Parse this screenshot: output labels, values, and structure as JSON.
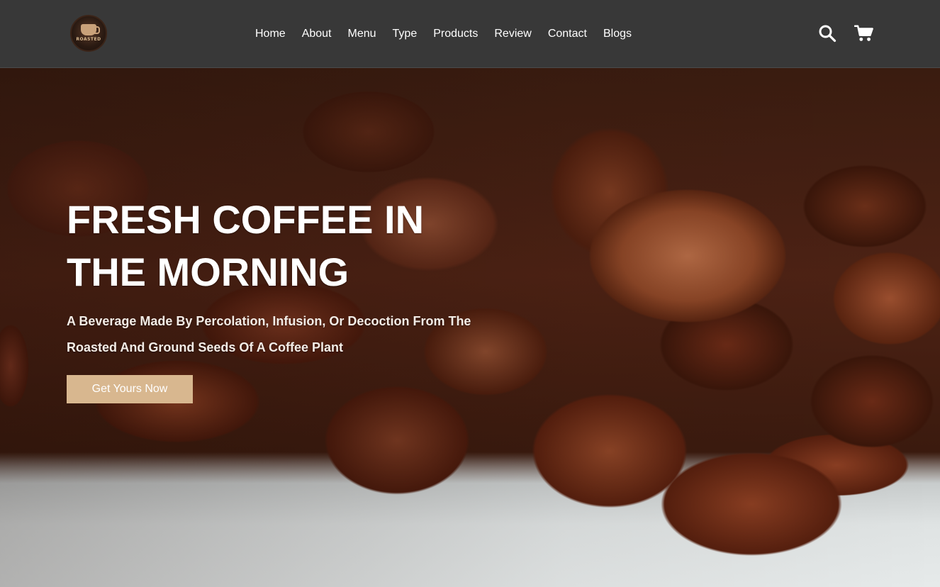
{
  "brand": {
    "logo_text": "ROASTED"
  },
  "nav": {
    "items": [
      {
        "label": "Home"
      },
      {
        "label": "About"
      },
      {
        "label": "Menu"
      },
      {
        "label": "Type"
      },
      {
        "label": "Products"
      },
      {
        "label": "Review"
      },
      {
        "label": "Contact"
      },
      {
        "label": "Blogs"
      }
    ]
  },
  "header_icons": {
    "search": "search-icon",
    "cart": "cart-icon"
  },
  "hero": {
    "title": "FRESH COFFEE IN THE MORNING",
    "subtitle": "A Beverage Made By Percolation, Infusion, Or Decoction From The Roasted And Ground Seeds Of A Coffee Plant",
    "cta_label": "Get Yours Now"
  },
  "colors": {
    "header_bg": "#383838",
    "cta_bg": "#d8b78f",
    "text_light": "#ffffff"
  }
}
